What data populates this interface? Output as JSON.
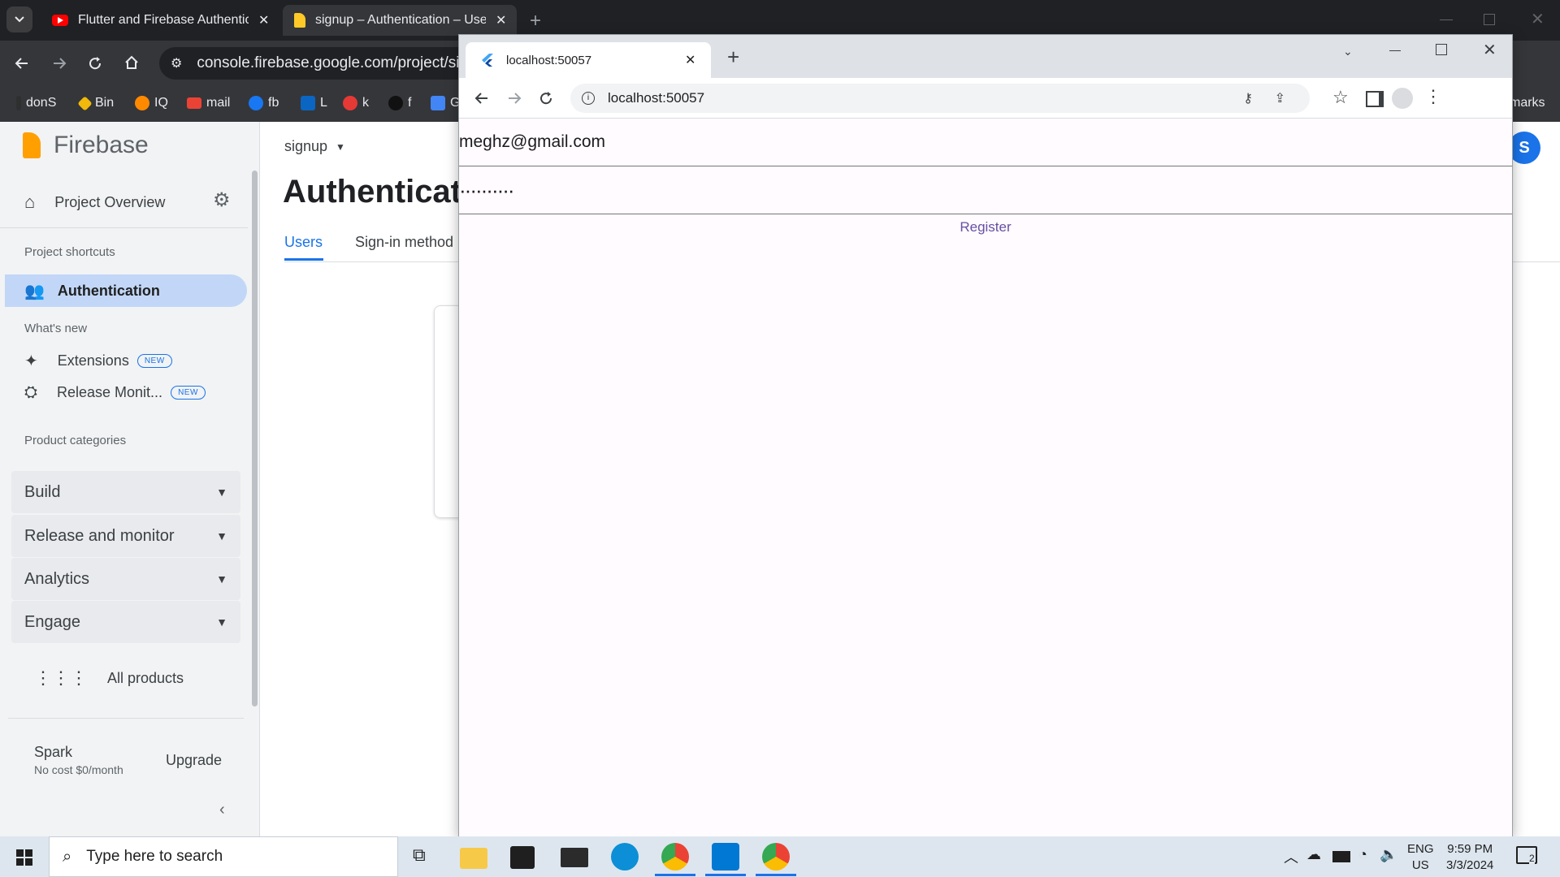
{
  "back_browser": {
    "tabs": [
      {
        "title": "Flutter and Firebase Authentica",
        "icon": "youtube-icon"
      },
      {
        "title": "signup – Authentication – Users",
        "icon": "firebase-icon"
      }
    ],
    "address": "console.firebase.google.com/project/signu",
    "bookmarks": [
      "donS",
      "Bin",
      "IQ",
      "mail",
      "fb",
      "L",
      "k",
      "f",
      "G"
    ],
    "bookmarks_overflow": "marks"
  },
  "firebase": {
    "brand": "Firebase",
    "project_overview": "Project Overview",
    "shortcuts_header": "Project shortcuts",
    "authentication": "Authentication",
    "whats_new": "What's new",
    "extensions": "Extensions",
    "release_monitor": "Release Monit...",
    "new_badge": "NEW",
    "product_categories": "Product categories",
    "categories": [
      "Build",
      "Release and monitor",
      "Analytics",
      "Engage"
    ],
    "all_products": "All products",
    "plan_name": "Spark",
    "plan_desc": "No cost $0/month",
    "upgrade": "Upgrade",
    "project_selector": "signup",
    "page_title": "Authenticat",
    "tabs": [
      "Users",
      "Sign-in method"
    ],
    "avatar_letter": "S"
  },
  "front_browser": {
    "tab_title": "localhost:50057",
    "address": "localhost:50057"
  },
  "app": {
    "email_value": "meghz@gmail.com",
    "password_value": "··········",
    "register_label": "Register"
  },
  "taskbar": {
    "search_placeholder": "Type here to search",
    "lang": "ENG",
    "region": "US",
    "time": "9:59 PM",
    "date": "3/3/2024",
    "notifications": "2"
  },
  "colors": {
    "accent": "#1a73e8",
    "flutter_accent": "#6750a4",
    "nav_active": "#c2d7f7"
  }
}
